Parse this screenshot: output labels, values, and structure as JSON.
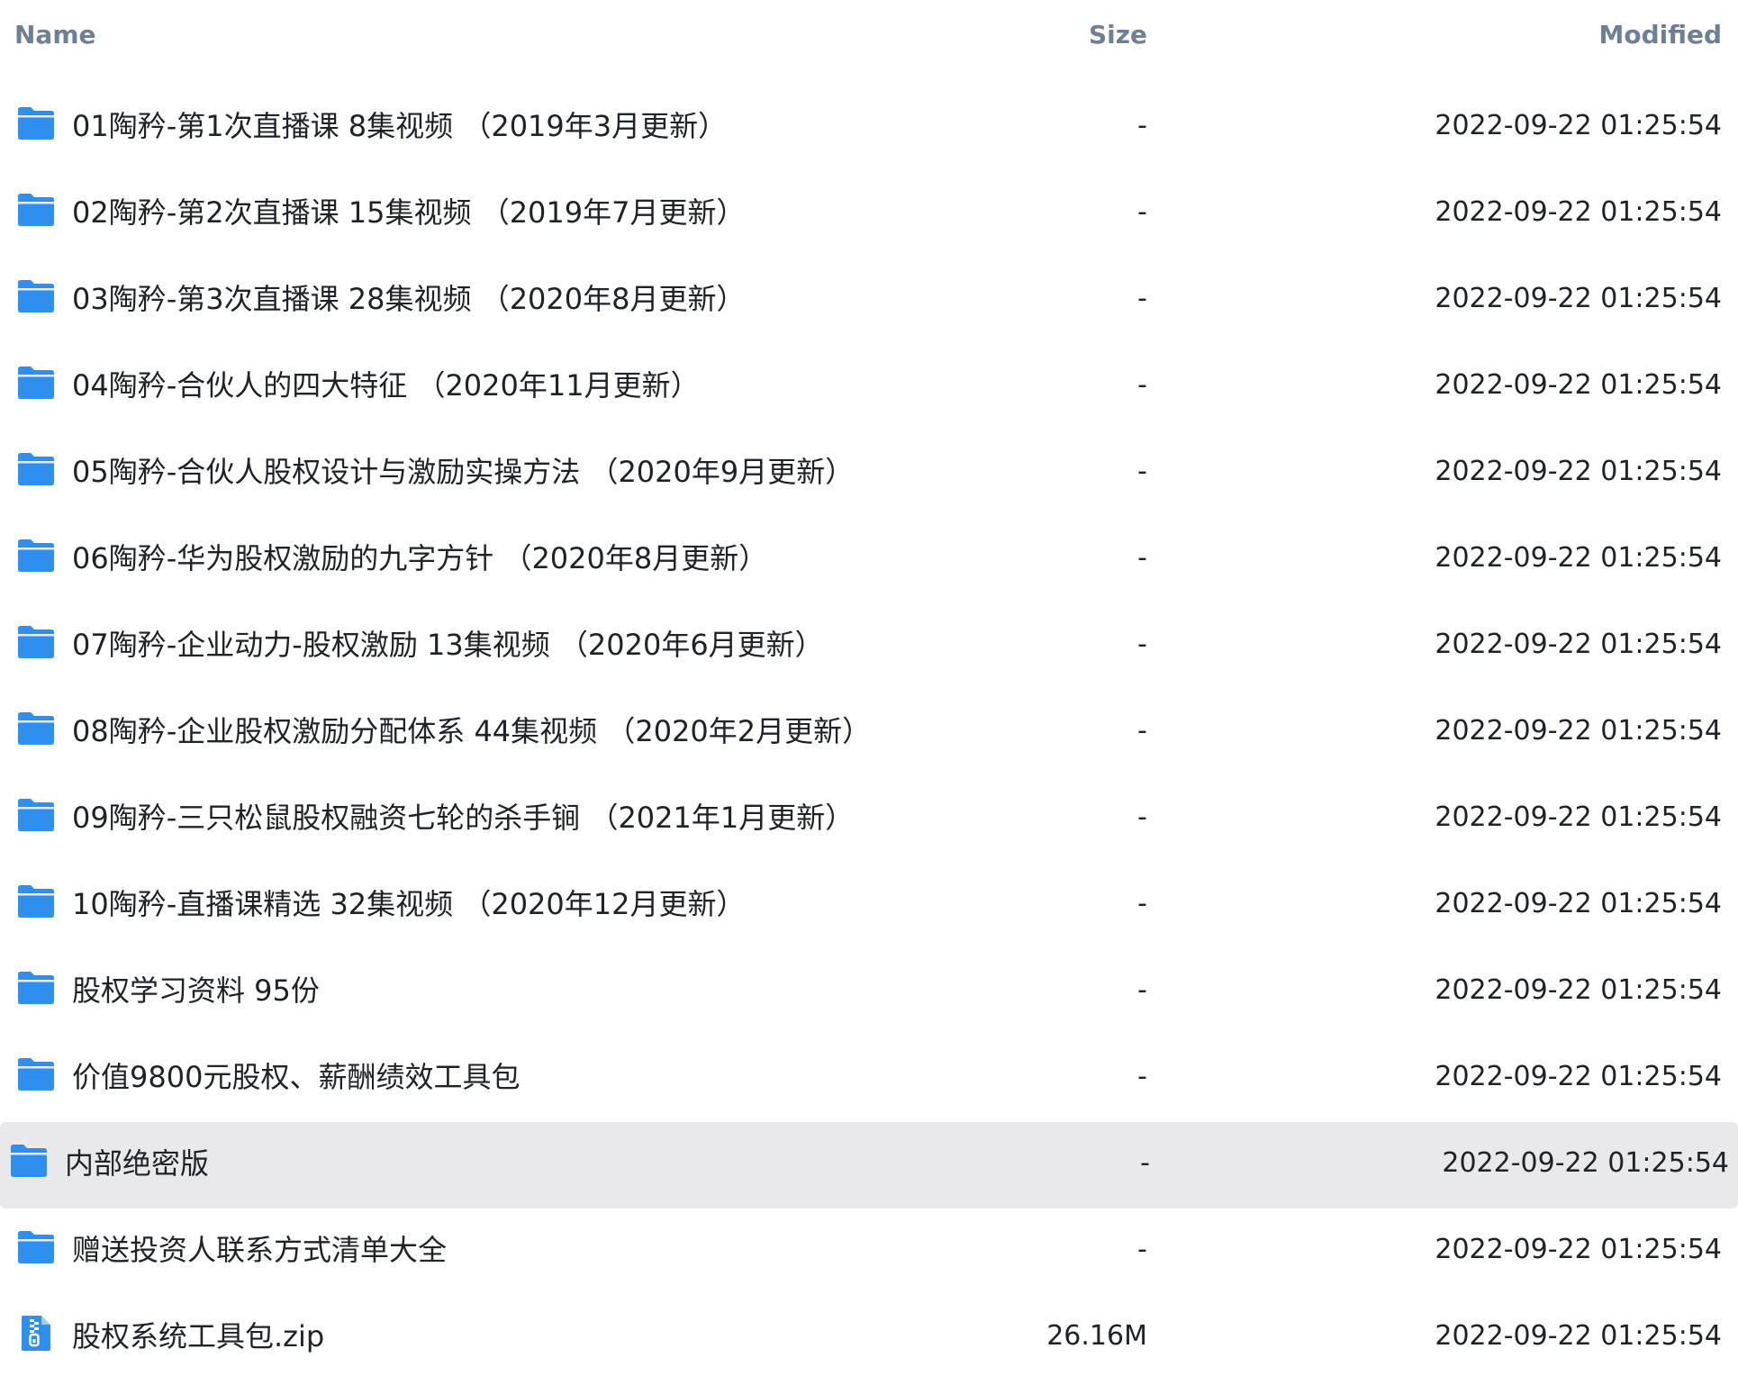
{
  "header": {
    "name_label": "Name",
    "size_label": "Size",
    "modified_label": "Modified"
  },
  "colors": {
    "folder": "#2f8fef",
    "header_text": "#6e7f96",
    "row_highlight": "#e9e9eb"
  },
  "files": [
    {
      "name": "01陶矜-第1次直播课 8集视频 （2019年3月更新）",
      "size": "-",
      "modified": "2022-09-22 01:25:54",
      "icon": "folder-icon"
    },
    {
      "name": "02陶矜-第2次直播课 15集视频 （2019年7月更新）",
      "size": "-",
      "modified": "2022-09-22 01:25:54",
      "icon": "folder-icon"
    },
    {
      "name": "03陶矜-第3次直播课 28集视频 （2020年8月更新）",
      "size": "-",
      "modified": "2022-09-22 01:25:54",
      "icon": "folder-icon"
    },
    {
      "name": "04陶矜-合伙人的四大特征 （2020年11月更新）",
      "size": "-",
      "modified": "2022-09-22 01:25:54",
      "icon": "folder-icon"
    },
    {
      "name": "05陶矜-合伙人股权设计与激励实操方法 （2020年9月更新）",
      "size": "-",
      "modified": "2022-09-22 01:25:54",
      "icon": "folder-icon"
    },
    {
      "name": "06陶矜-华为股权激励的九字方针 （2020年8月更新）",
      "size": "-",
      "modified": "2022-09-22 01:25:54",
      "icon": "folder-icon"
    },
    {
      "name": "07陶矜-企业动力-股权激励 13集视频 （2020年6月更新）",
      "size": "-",
      "modified": "2022-09-22 01:25:54",
      "icon": "folder-icon"
    },
    {
      "name": "08陶矜-企业股权激励分配体系 44集视频 （2020年2月更新）",
      "size": "-",
      "modified": "2022-09-22 01:25:54",
      "icon": "folder-icon"
    },
    {
      "name": "09陶矜-三只松鼠股权融资七轮的杀手锏 （2021年1月更新）",
      "size": "-",
      "modified": "2022-09-22 01:25:54",
      "icon": "folder-icon"
    },
    {
      "name": "10陶矜-直播课精选 32集视频 （2020年12月更新）",
      "size": "-",
      "modified": "2022-09-22 01:25:54",
      "icon": "folder-icon"
    },
    {
      "name": "股权学习资料 95份",
      "size": "-",
      "modified": "2022-09-22 01:25:54",
      "icon": "folder-icon"
    },
    {
      "name": "价值9800元股权、薪酬绩效工具包",
      "size": "-",
      "modified": "2022-09-22 01:25:54",
      "icon": "folder-icon"
    },
    {
      "name": "内部绝密版",
      "size": "-",
      "modified": "2022-09-22 01:25:54",
      "icon": "folder-icon",
      "highlighted": true
    },
    {
      "name": "赠送投资人联系方式清单大全",
      "size": "-",
      "modified": "2022-09-22 01:25:54",
      "icon": "folder-icon"
    },
    {
      "name": "股权系统工具包.zip",
      "size": "26.16M",
      "modified": "2022-09-22 01:25:54",
      "icon": "zip-file-icon"
    }
  ]
}
